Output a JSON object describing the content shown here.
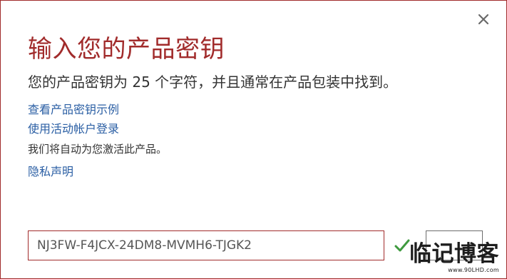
{
  "dialog": {
    "title": "输入您的产品密钥",
    "subtitle": "您的产品密钥为 25 个字符，并且通常在产品包装中找到。",
    "links": {
      "view_example": "查看产品密钥示例",
      "use_account": "使用活动帐户登录",
      "privacy": "隐私声明"
    },
    "note": "我们将自动为您激活此产品。",
    "product_key": {
      "value": "NJ3FW-F4JCX-24DM8-MVMH6-TJGK2"
    }
  },
  "watermark": {
    "main": "临记博客",
    "sub": "www.90LHD.com"
  },
  "colors": {
    "accent": "#a12b2b",
    "link": "#2b5fa4",
    "check": "#3f9a3f",
    "text": "#333333"
  },
  "icons": {
    "close": "close-icon",
    "check": "checkmark-icon"
  }
}
